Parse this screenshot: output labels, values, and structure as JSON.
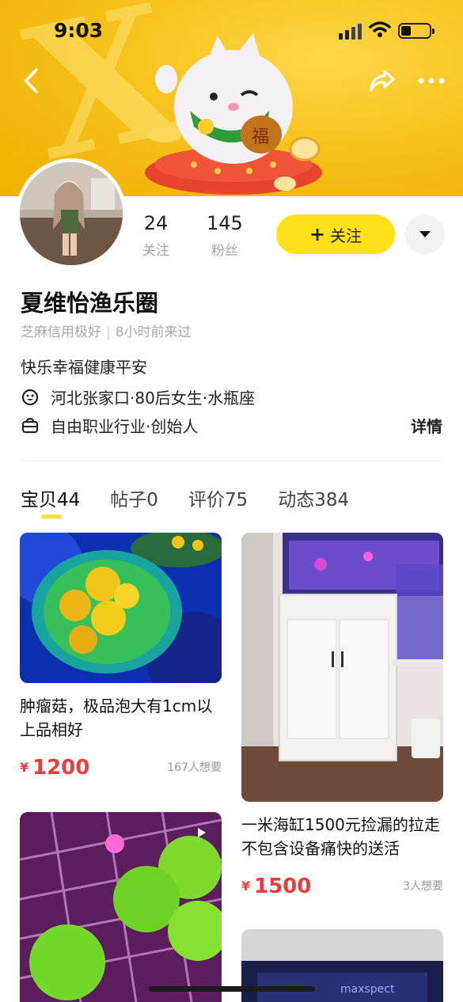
{
  "status": {
    "time": "9:03"
  },
  "profile": {
    "name": "夏维怡渔乐圈",
    "credit": "芝麻信用极好",
    "last_seen": "8小时前来过",
    "bio": "快乐幸福健康平安",
    "location": "河北张家口·80后女生·水瓶座",
    "profession": "自由职业行业·创始人",
    "details_label": "详情"
  },
  "stats": [
    {
      "value": "24",
      "label": "关注"
    },
    {
      "value": "145",
      "label": "粉丝"
    }
  ],
  "follow_label": "关注",
  "tabs": [
    {
      "label": "宝贝",
      "count": "44"
    },
    {
      "label": "帖子",
      "count": "0"
    },
    {
      "label": "评价",
      "count": "75"
    },
    {
      "label": "动态",
      "count": "384"
    }
  ],
  "items": [
    {
      "title": "肿瘤菇，极品泡大有1cm以上品相好",
      "currency": "¥",
      "price": "1200",
      "wants": "167人想要"
    },
    {
      "title": "一米海缸1500元捡漏的拉走不包含设备痛快的送活",
      "currency": "¥",
      "price": "1500",
      "wants": "3人想要"
    }
  ],
  "icons": {
    "back": "chevron-left-icon",
    "share": "share-icon",
    "more": "more-dots-icon",
    "dropdown": "chevron-down-icon",
    "location": "smile-face-icon",
    "profession": "briefcase-icon"
  },
  "colors": {
    "accent": "#ffe11a",
    "price": "#ef3b3b",
    "banner": "#f7c21c"
  }
}
